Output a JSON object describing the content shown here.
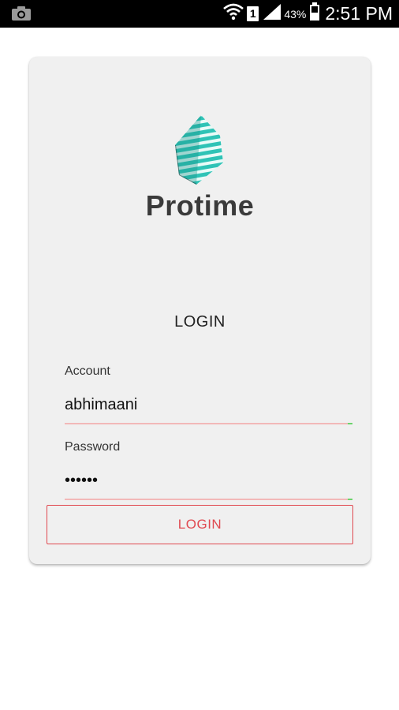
{
  "status_bar": {
    "battery_percent": "43%",
    "sim_slot": "1",
    "time": "2:51 PM",
    "icons": [
      "camera-icon",
      "wifi-icon",
      "sim-icon",
      "signal-icon",
      "battery-icon"
    ]
  },
  "app": {
    "brand_name": "Protime",
    "colors": {
      "accent": "#e0484f",
      "logo_teal": "#2fc3b6",
      "underline": "#f2b8b8",
      "valid": "#6cd36c"
    }
  },
  "login_form": {
    "heading": "LOGIN",
    "account_label": "Account",
    "account_value": "abhimaani",
    "password_label": "Password",
    "password_value": "••••••",
    "submit_label": "LOGIN"
  }
}
